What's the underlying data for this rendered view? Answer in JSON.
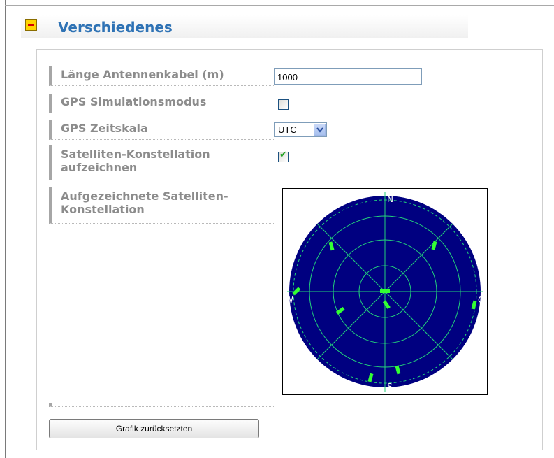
{
  "section": {
    "title": "Verschiedenes",
    "collapse_icon": "minus-icon"
  },
  "fields": {
    "antenna_cable": {
      "label": "Länge Antennenkabel (m)",
      "value": "1000"
    },
    "gps_simulation": {
      "label": "GPS Simulationsmodus",
      "checked": false
    },
    "gps_timescale": {
      "label": "GPS Zeitskala",
      "selected": "UTC"
    },
    "record_constellation": {
      "label_line1": "Satelliten-Konstellation",
      "label_line2": "aufzeichnen",
      "checked": true
    },
    "recorded_constellation": {
      "label_line1": "Aufgezeichnete Satelliten-",
      "label_line2": "Konstellation"
    }
  },
  "skyplot": {
    "directions": {
      "north": "N",
      "south": "S",
      "west": "W",
      "east": "O"
    },
    "colors": {
      "background": "#000080",
      "grid": "#22d17a",
      "satellite": "#33ff33"
    }
  },
  "reset_button": {
    "label": "Grafik zurücksetzten"
  }
}
